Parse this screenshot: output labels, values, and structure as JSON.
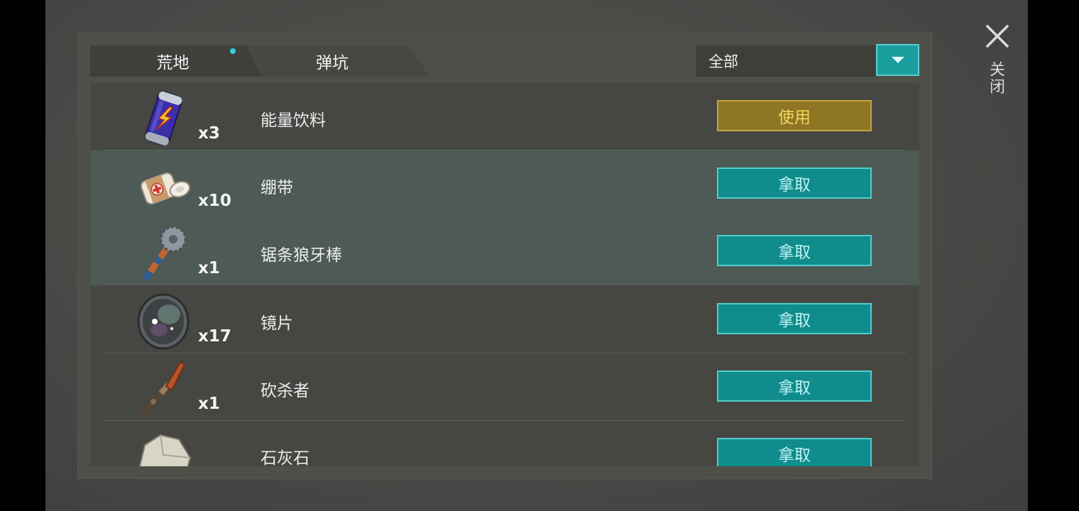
{
  "tabs": [
    {
      "label": "荒地"
    },
    {
      "label": "弹坑"
    }
  ],
  "filter": {
    "selected": "全部"
  },
  "close_label": "关闭",
  "items": [
    {
      "name": "能量饮料",
      "qty": "x3",
      "action": "使用",
      "icon": "energy-drink-icon"
    },
    {
      "name": "绷带",
      "qty": "x10",
      "action": "拿取",
      "icon": "bandage-icon"
    },
    {
      "name": "锯条狼牙棒",
      "qty": "x1",
      "action": "拿取",
      "icon": "saw-mace-icon"
    },
    {
      "name": "镜片",
      "qty": "x17",
      "action": "拿取",
      "icon": "lens-icon"
    },
    {
      "name": "砍杀者",
      "qty": "x1",
      "action": "拿取",
      "icon": "machete-icon"
    },
    {
      "name": "石灰石",
      "qty": "",
      "action": "拿取",
      "icon": "limestone-icon"
    }
  ],
  "colors": {
    "accent": "#108c8d",
    "use_button": "#8e7625",
    "indicator": "#2ed4d4"
  }
}
